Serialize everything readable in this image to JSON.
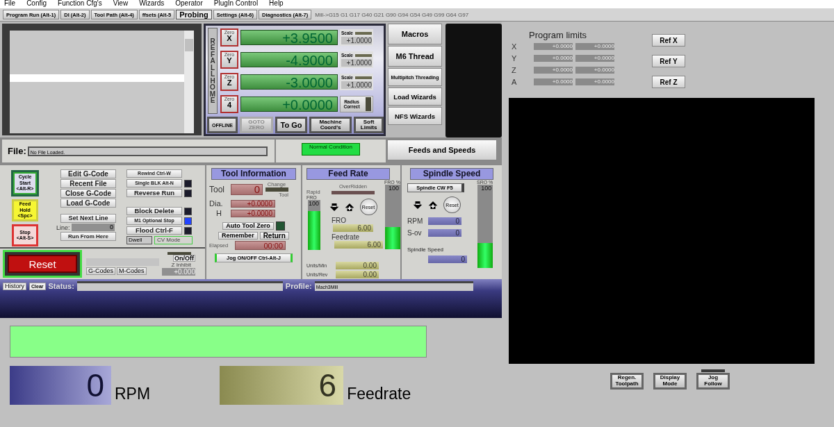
{
  "menu": [
    "File",
    "Config",
    "Function Cfg's",
    "View",
    "Wizards",
    "Operator",
    "PlugIn Control",
    "Help"
  ],
  "tabs": [
    {
      "label": "Program Run (Alt-1)",
      "selected": false
    },
    {
      "label": "DI (Alt-2)",
      "selected": false
    },
    {
      "label": "Tool Path (Alt-4)",
      "selected": false
    },
    {
      "label": "ffsets (Alt-5",
      "selected": false
    },
    {
      "label": "Probing",
      "selected": true
    },
    {
      "label": "Settings (Alt-6)",
      "selected": false
    },
    {
      "label": "Diagnostics (Alt-7)",
      "selected": false
    }
  ],
  "modal_codes": "Mill->G15  G1 G17 G40 G21 G90 G94 G54 G49 G99 G64 G97",
  "dro": {
    "ref_all_home": "REF ALL HOME",
    "axes": [
      {
        "zero": "Zero",
        "axis": "X",
        "value": "+3.9500",
        "kind": "scale",
        "label": "Scale",
        "setting": "+1.0000"
      },
      {
        "zero": "Zero",
        "axis": "Y",
        "value": "-4.9000",
        "kind": "scale",
        "label": "Scale",
        "setting": "+1.0000"
      },
      {
        "zero": "Zero",
        "axis": "Z",
        "value": "-3.0000",
        "kind": "scale",
        "label": "Scale",
        "setting": "+1.0000"
      },
      {
        "zero": "Zero",
        "axis": "4",
        "value": "+0.0000",
        "kind": "radius",
        "label": "Radius Correct"
      }
    ],
    "buttons": [
      {
        "label": "OFFLINE",
        "disabled": false
      },
      {
        "label": "GOTO ZERO",
        "disabled": true
      },
      {
        "label": "To Go",
        "disabled": false
      },
      {
        "label": "Machine Coord's",
        "disabled": false
      },
      {
        "label": "Soft Limits",
        "disabled": false
      }
    ]
  },
  "side_buttons": [
    {
      "label": "Macros",
      "kind": "large"
    },
    {
      "label": "M6 Thread",
      "kind": "large"
    },
    {
      "label": "Multipitch Threading",
      "kind": "small"
    },
    {
      "label": "Load Wizards",
      "kind": "medium"
    },
    {
      "label": "NFS Wizards",
      "kind": "medium"
    }
  ],
  "file": {
    "label": "File:",
    "value": "No File Loaded."
  },
  "condition": "Normal Condition",
  "feeds_and_speeds": "Feeds and Speeds",
  "program": {
    "cycle": [
      {
        "label": "Cycle Start\n<Alt-R>",
        "kind": "start"
      },
      {
        "label": "Feed Hold\n<Spc>",
        "kind": "hold"
      },
      {
        "label": "Stop\n<Alt-S>",
        "kind": "stop"
      }
    ],
    "code_buttons": [
      "Edit G-Code",
      "Recent File",
      "Close G-Code",
      "Load G-Code"
    ],
    "set_next_line": "Set Next Line",
    "line_label": "Line:",
    "line": "0",
    "run_from_here": "Run From Here",
    "toggles": [
      {
        "label": "Rewind Ctrl-W",
        "kind": "plain"
      },
      {
        "label": "Single BLK Alt-N",
        "kind": "led",
        "on": false
      },
      {
        "label": "Reverse Run",
        "kind": "led",
        "on": false
      },
      {
        "label": "Block Delete",
        "kind": "led",
        "on": false
      },
      {
        "label": "M1 Optional Stop",
        "kind": "led",
        "on": true
      },
      {
        "label": "Flood Ctrl-F",
        "kind": "led",
        "on": false
      }
    ],
    "dwell": "Dwell",
    "cv_mode": "CV Mode",
    "reset": "Reset",
    "gcodes": "G-Codes",
    "mcodes": "M-Codes",
    "z_inhibit_button": "On/Off",
    "z_inhibit_label": "Z Inhibit",
    "z_inhibit": "+0.000"
  },
  "tool": {
    "title": "Tool Information",
    "tool_label": "Tool",
    "tool": "0",
    "change": "Change",
    "change_sub": "Tool",
    "dia_label": "Dia.",
    "dia": "+0.0000",
    "h_label": "H",
    "h": "+0.0000",
    "auto_zero": "Auto Tool Zero",
    "auto_zero_on": false,
    "remember": "Remember",
    "return": "Return",
    "elapsed_label": "Elapsed",
    "elapsed": "00:00",
    "jog": "Jog ON/OFF Ctrl-Alt-J"
  },
  "feed": {
    "title": "Feed Rate",
    "overridden": "OverRidden",
    "pct_label": "FRO %",
    "rapid": {
      "label": "Rapid",
      "fro": "FRO",
      "value": "100",
      "level": 0.78
    },
    "reset": "Reset",
    "fro_label": "FRO",
    "fro": "6.00",
    "feedrate_label": "Feedrate",
    "feedrate": "6.00",
    "units_min_label": "Units/Min",
    "units_min": "0.00",
    "units_rev_label": "Units/Rev",
    "units_rev": "0.00",
    "pct_value": "100",
    "level": 0.34
  },
  "spindle": {
    "title": "Spindle Speed",
    "button": "Spindle CW F5",
    "pct_label": "SRO %",
    "reset": "Reset",
    "rpm_label": "RPM",
    "rpm": "0",
    "sov_label": "S-ov",
    "sov": "0",
    "speed_label": "Spindle Speed",
    "speed": "0",
    "pct_value": "100",
    "level": 0.3
  },
  "status": {
    "history": "History",
    "clear": "Clear",
    "status_label": "Status:",
    "profile_label": "Profile:",
    "profile": "Mach3Mill"
  },
  "limits": {
    "title": "Program limits",
    "rows": [
      {
        "axis": "X",
        "min": "+0.0000",
        "max": "+0.0000"
      },
      {
        "axis": "Y",
        "min": "+0.0000",
        "max": "+0.0000"
      },
      {
        "axis": "Z",
        "min": "+0.0000",
        "max": "+0.0000"
      },
      {
        "axis": "A",
        "min": "+0.0000",
        "max": "+0.0000"
      }
    ]
  },
  "ref_buttons": [
    "Ref X",
    "Ref Y",
    "Ref Z"
  ],
  "view_buttons": [
    {
      "label": "Regen.\nToolpath",
      "led": false
    },
    {
      "label": "Display\nMode",
      "led": false
    },
    {
      "label": "Jog\nFollow",
      "led": true
    }
  ],
  "rpm_display": {
    "value": "0",
    "label": "RPM"
  },
  "feed_display": {
    "value": "6",
    "label": "Feedrate"
  }
}
